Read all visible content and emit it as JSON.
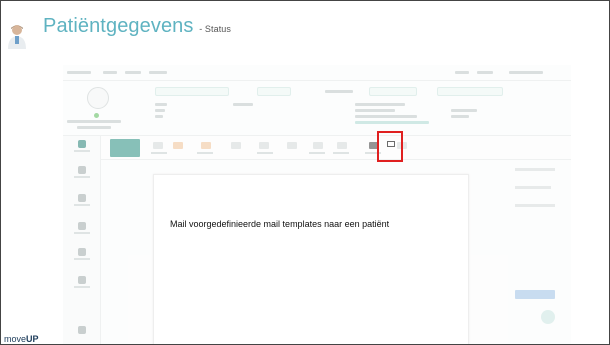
{
  "slide": {
    "title": "Patiëntgegevens",
    "subtitle": "- Status",
    "brand_prefix": "move",
    "brand_suffix": "UP"
  },
  "modal": {
    "text": "Mail voorgedefinieerde mail templates naar een patiënt"
  },
  "colors": {
    "title_teal": "#5fb3c1",
    "highlight_red": "#e02020",
    "app_green": "#3e9b8d"
  },
  "icons": {
    "avatar": "doctor-avatar-icon",
    "mail": "mail-icon"
  }
}
